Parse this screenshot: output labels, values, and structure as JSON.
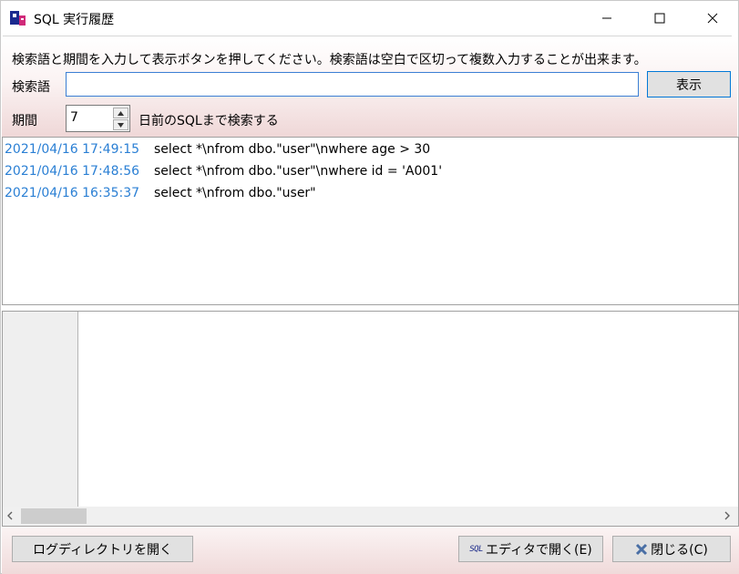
{
  "window": {
    "title": "SQL 実行履歴",
    "icon": "app-logo-icon"
  },
  "search": {
    "instruction": "検索語と期間を入力して表示ボタンを押してください。検索語は空白で区切って複数入力することが出来ます。",
    "keyword_label": "検索語",
    "keyword_value": "",
    "show_button": "表示",
    "period_label": "期間",
    "period_value": "7",
    "period_suffix": "日前のSQLまで検索する"
  },
  "history": [
    {
      "date": "2021/04/16 17:49:15",
      "sql": "select *\\nfrom dbo.\"user\"\\nwhere age > 30"
    },
    {
      "date": "2021/04/16 17:48:56",
      "sql": "select *\\nfrom dbo.\"user\"\\nwhere id = 'A001'"
    },
    {
      "date": "2021/04/16 16:35:37",
      "sql": "select *\\nfrom dbo.\"user\""
    }
  ],
  "footer": {
    "log_dir_button": "ログディレクトリを開く",
    "open_editor_button": "エディタで開く(E)",
    "close_button": "閉じる(C)",
    "sql_badge": "SQL"
  },
  "colors": {
    "date_text": "#2a7fd4",
    "gradient_bottom": "#efd7d7"
  }
}
